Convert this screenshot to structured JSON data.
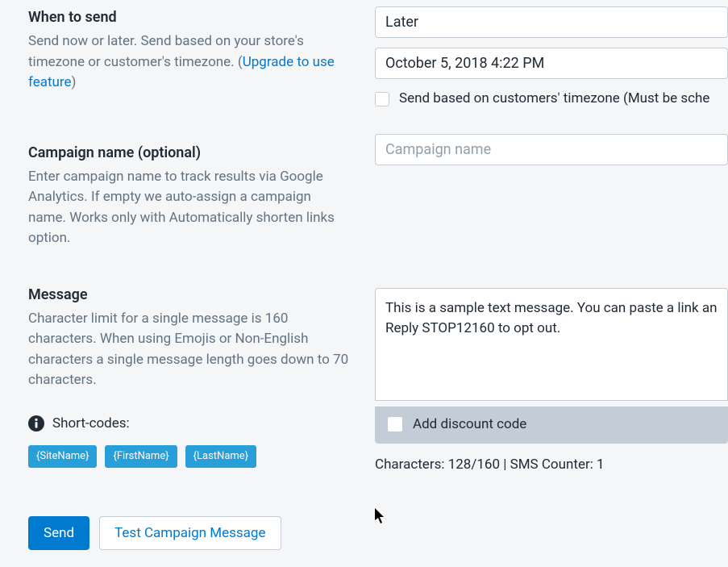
{
  "when": {
    "title": "When to send",
    "desc_pre": "Send now or later. Send based on your store's timezone or customer's timezone. (",
    "upgrade_link": "Upgrade to use feature",
    "desc_post": ")",
    "select_value": "Later",
    "datetime_value": "October 5, 2018 4:22 PM",
    "timezone_checkbox_label": "Send based on customers' timezone (Must be sche"
  },
  "campaign": {
    "title": "Campaign name (optional)",
    "desc": "Enter campaign name to track results via Google Analytics. If empty we auto-assign a campaign name. Works only with Automatically shorten links option.",
    "placeholder": "Campaign name"
  },
  "msg": {
    "title": "Message",
    "desc": "Character limit for a single message is 160 characters. When using Emojis or Non-English characters a single message length goes down to 70 characters.",
    "shortcodes_label": "Short-codes:",
    "shortcodes": [
      "{SiteName}",
      "{FirstName}",
      "{LastName}"
    ],
    "textarea_value": "This is a sample text message. You can paste a link an\nReply STOP12160 to opt out.",
    "discount_label": "Add discount code",
    "counter": "Characters: 128/160 | SMS Counter: 1"
  },
  "buttons": {
    "send": "Send",
    "test": "Test Campaign Message"
  }
}
